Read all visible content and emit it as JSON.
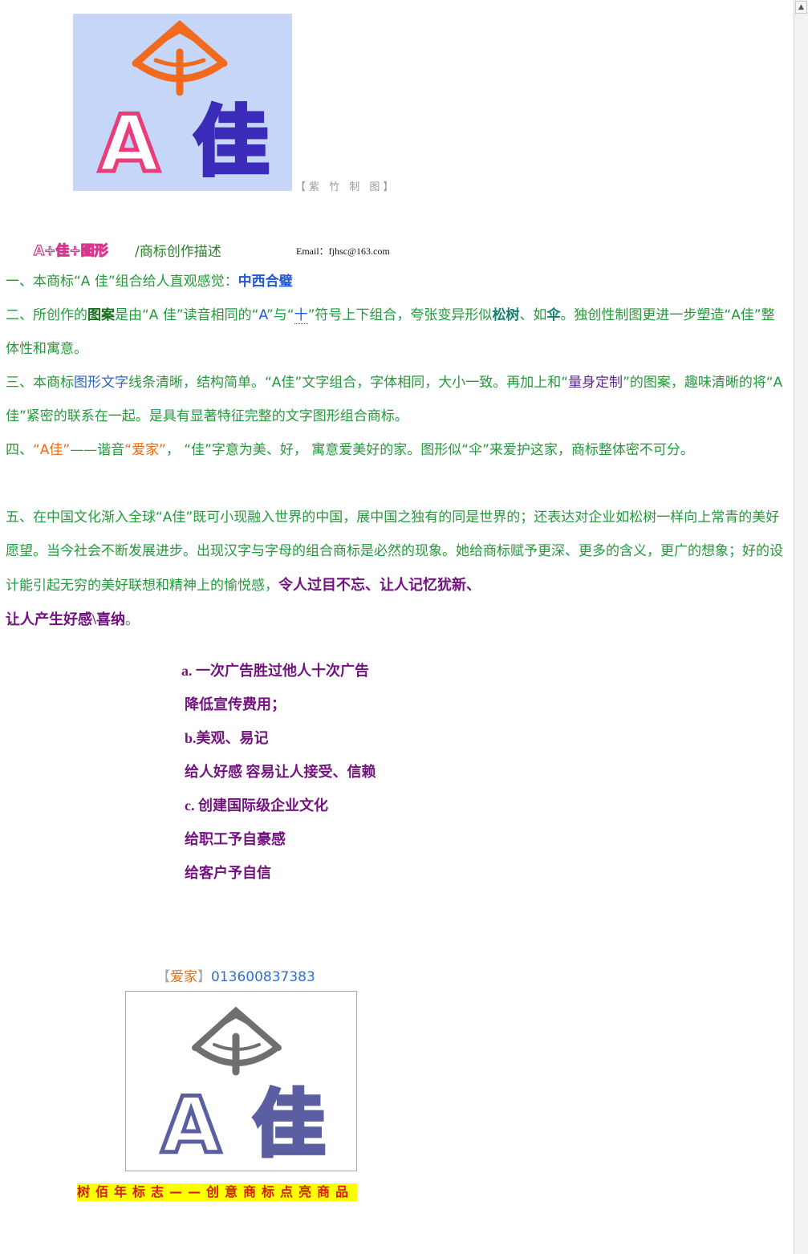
{
  "logo_top": {
    "text_a": "A",
    "text_jia": "佳",
    "caption": "【紫 竹 制 图】",
    "colors": {
      "background": "#c5d6f8",
      "umbrella": "#f26a1d",
      "letter_a": "#e83d7a",
      "letter_jia": "#3a2bb8"
    }
  },
  "heading": {
    "art_title": "A+佳+图形",
    "subtitle": "/商标创作描述",
    "email": "Email：fjhsc@163.com"
  },
  "p1": {
    "prefix": "一、本商标“A 佳”组合给人直观感觉：",
    "highlight": "中西合璧"
  },
  "p2": {
    "t1": "二、所创作的",
    "t2": "图案",
    "t3": "是由“A 佳”读音相同的“",
    "t4": "A",
    "t5": "”与“",
    "t6": "十",
    "t7": "”符号上下组合，夸张变异形似",
    "t8": "松树",
    "t9": "、如",
    "t10": "伞",
    "t11": "。独创性制图更进一步塑造“A佳”整体性和寓意。"
  },
  "p3": {
    "t1": "三、本商标",
    "t2": "图形文字",
    "t3": "线条清晰，结构简单。“A佳”文字组合，字体相同，大小一致。再加上和“",
    "t4": "量身定制",
    "t5": "”的图案，趣味清晰的将“A 佳”紧密的联系在一起。是具有显著特征完整的文字图形组合商标。"
  },
  "p4": {
    "t1": "四、",
    "t2": "“A佳”",
    "t3": "——谐音",
    "t4": "“爱家”",
    "t5": "，  “佳”字意为美、好，  寓意爱美好的家。图形似“伞”来爱护这家，商标整体密不可分。"
  },
  "p5": {
    "t1": "五、在中国文化渐入全球“A佳”既可小现融入世界的中国，展中国之独有的同是世界的；还表达对企业如松树一样向上常青的美好愿望。当今社会不断发展进步。出现汉字与字母的组合商标是必然的现象。她给商标赋予更深、更多的含义，更广的想象；好的设计能引起无穷的美好联想和精神上的愉悦感，",
    "t2": "令人过目不忘、让人记忆犹新、",
    "t3": "让人产生好感\\喜纳",
    "t4": "。"
  },
  "benefits": [
    "a. 一次广告胜过他人十次广告",
    "降低宣传费用；",
    "b.美观、易记",
    "给人好感  容易让人接受、信赖",
    "c. 创建国际级企业文化",
    "给职工予自豪感",
    "给客户予自信"
  ],
  "contact": {
    "open": "【",
    "name": "爱家",
    "close": "】",
    "phone": "013600837383"
  },
  "logo_bottom": {
    "text_a": "A",
    "text_jia": "佳",
    "colors": {
      "umbrella": "#6f6f6f",
      "letters": "#5b5ea0"
    }
  },
  "slogan": "树佰年标志——创意商标点亮商品"
}
